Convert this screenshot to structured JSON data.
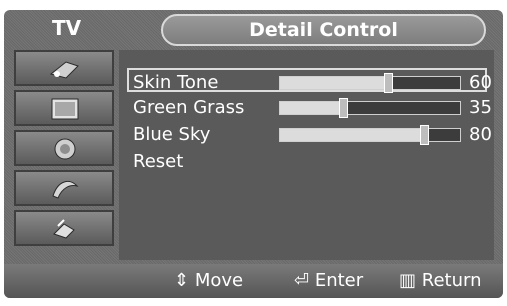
{
  "tv_label": "TV",
  "title": "Detail Control",
  "items": [
    {
      "label": "Skin Tone",
      "value": "60",
      "level": 60,
      "selected": true
    },
    {
      "label": "Green Grass",
      "value": "35",
      "level": 35,
      "selected": false
    },
    {
      "label": "Blue Sky",
      "value": "80",
      "level": 80,
      "selected": false
    },
    {
      "label": "Reset",
      "value": "",
      "level": null,
      "selected": false
    }
  ],
  "footer": {
    "move": {
      "label": "Move",
      "icon": "up-down-arrows-icon"
    },
    "enter": {
      "label": "Enter",
      "icon": "enter-icon"
    },
    "return": {
      "label": "Return",
      "icon": "return-icon"
    }
  },
  "sidebar_icons": [
    "input-icon",
    "picture-icon",
    "sound-icon",
    "channel-icon",
    "setup-icon"
  ]
}
